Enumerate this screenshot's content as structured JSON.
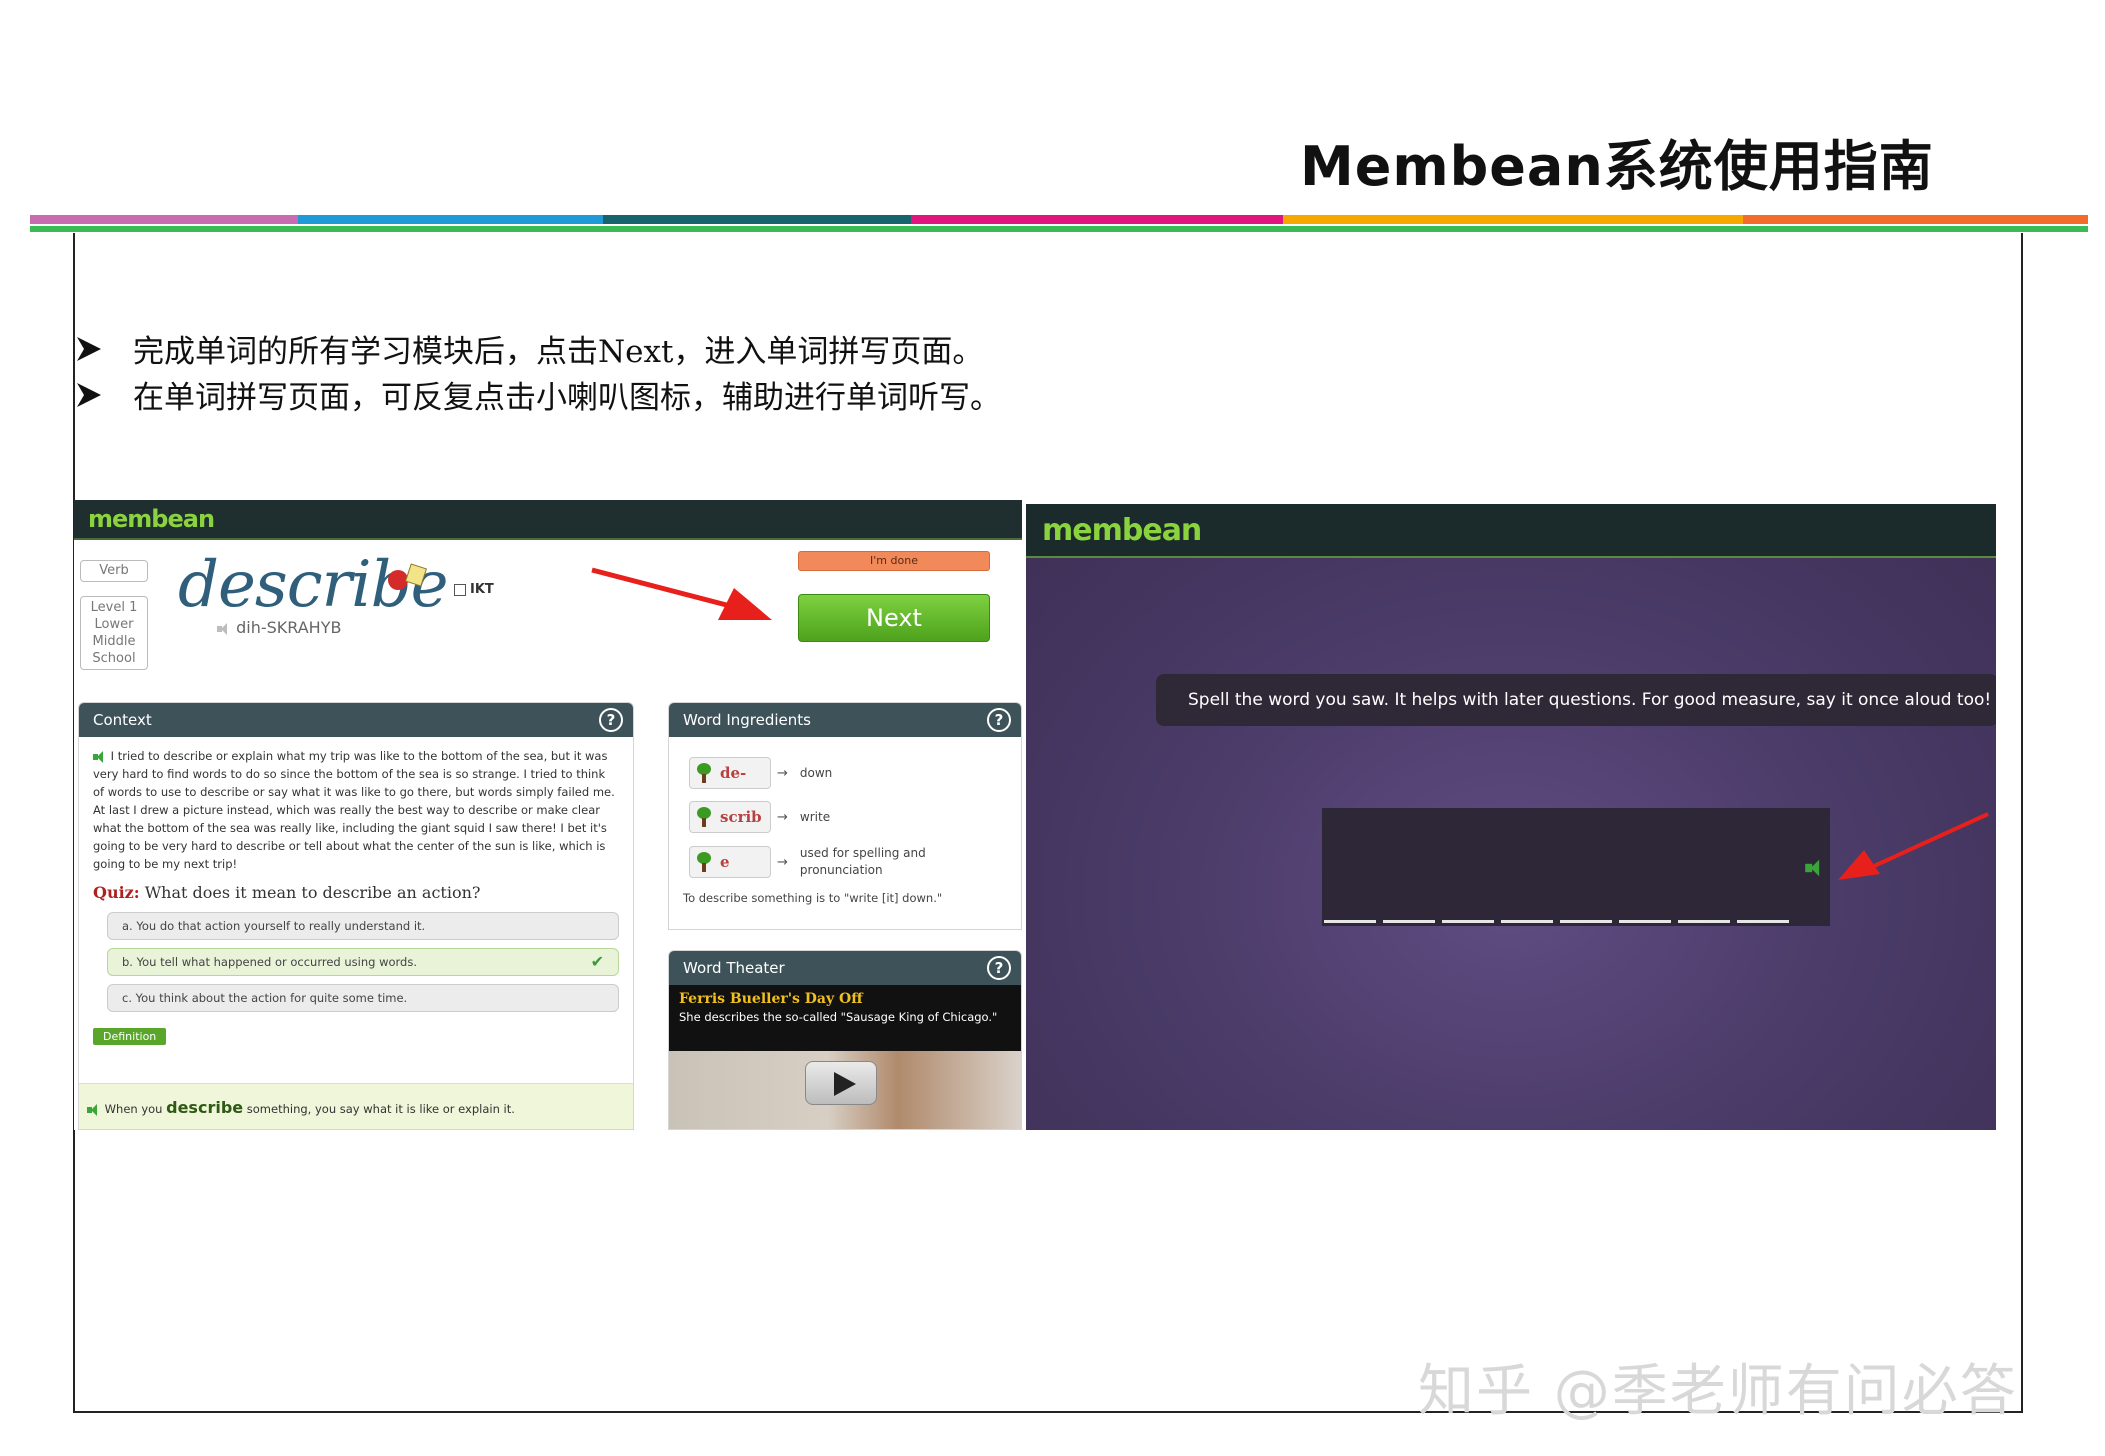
{
  "slide": {
    "title": "Membean系统使用指南",
    "bullets": [
      "完成单词的所有学习模块后，点击Next，进入单词拼写页面。",
      "在单词拼写页面，可反复点击小喇叭图标，辅助进行单词听写。"
    ],
    "watermark": "知乎 @季老师有问必答",
    "band_colors": [
      "#c86bb0",
      "#1e9ad6",
      "#17636e",
      "#e0157e",
      "#f7a800",
      "#f26b2a"
    ]
  },
  "left_screen": {
    "logo": "membean",
    "side": {
      "pos": "Verb",
      "level_lines": [
        "Level 1",
        "Lower",
        "Middle",
        "School"
      ]
    },
    "word": "describe",
    "ikt_label": "IKT",
    "pronunciation": "dih-SKRAHYB",
    "done_button": "I'm done",
    "next_button": "Next",
    "context": {
      "heading": "Context",
      "passage": "I tried to describe or explain what my trip was like to the bottom of the sea, but it was very hard to find words to do so since the bottom of the sea is so strange. I tried to think of words to use to describe or say what it was like to go there, but words simply failed me. At last I drew a picture instead, which was really the best way to describe or make clear what the bottom of the sea was really like, including the giant squid I saw there! I bet it's going to be very hard to describe or tell about what the center of the sun is like, which is going to be my next trip!",
      "quiz_label": "Quiz:",
      "quiz_question": "What does it mean to describe an action?",
      "options": [
        "a. You do that action yourself to really understand it.",
        "b. You tell what happened or occurred using words.",
        "c. You think about the action for quite some time."
      ],
      "correct_index": 1,
      "definition_button": "Definition",
      "definition_prefix": "When you",
      "definition_word": "describe",
      "definition_suffix": "something, you say what it is like or explain it."
    },
    "ingredients": {
      "heading": "Word Ingredients",
      "items": [
        {
          "part": "de-",
          "meaning": "down"
        },
        {
          "part": "scrib",
          "meaning": "write"
        },
        {
          "part": "e",
          "meaning": "used for spelling and pronunciation"
        }
      ],
      "summary": "To describe something is to \"write [it] down.\""
    },
    "theater": {
      "heading": "Word Theater",
      "movie": "Ferris Bueller's Day Off",
      "description": "She describes the so-called \"Sausage King of Chicago.\""
    }
  },
  "right_screen": {
    "logo": "membean",
    "instruction": "Spell the word you saw. It helps with later questions. For good measure, say it once aloud too!",
    "blank_count": 8
  }
}
